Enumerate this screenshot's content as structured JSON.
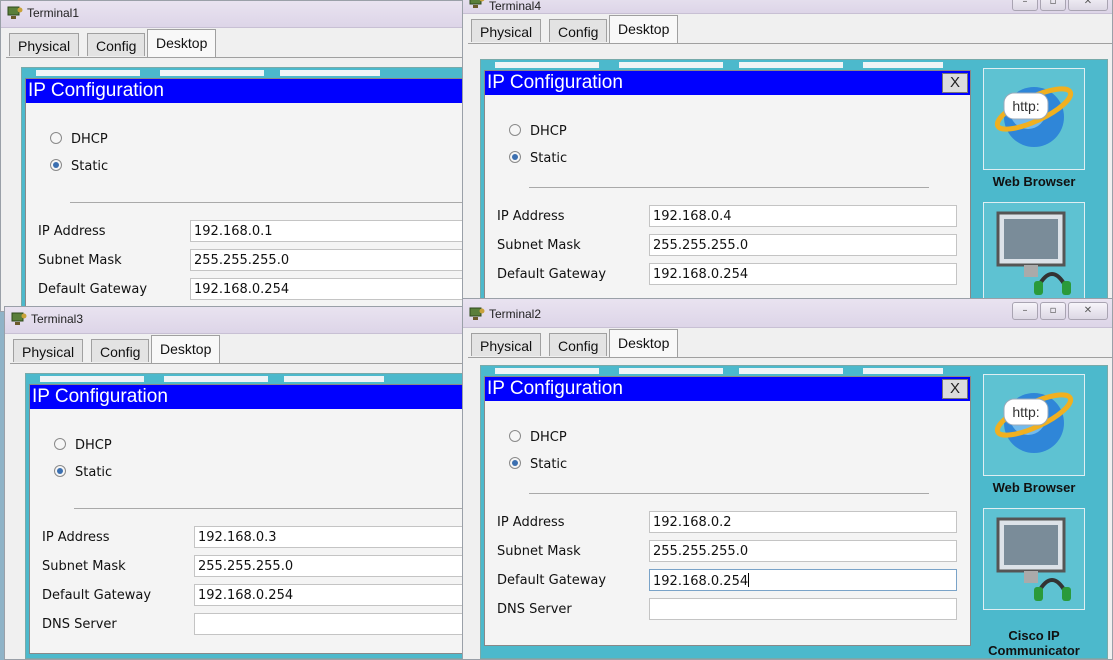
{
  "windows": {
    "terminal1": {
      "title": "Terminal1",
      "tabs": [
        "Physical",
        "Config",
        "Desktop"
      ],
      "panel_title": "IP Configuration",
      "dhcp_label": "DHCP",
      "static_label": "Static",
      "selected_mode": "Static",
      "ip_label": "IP Address",
      "ip_value": "192.168.0.1",
      "mask_label": "Subnet Mask",
      "mask_value": "255.255.255.0",
      "gw_label": "Default Gateway",
      "gw_value": "192.168.0.254"
    },
    "terminal4": {
      "title": "Terminal4",
      "tabs": [
        "Physical",
        "Config",
        "Desktop"
      ],
      "panel_title": "IP Configuration",
      "close_label": "X",
      "dhcp_label": "DHCP",
      "static_label": "Static",
      "selected_mode": "Static",
      "ip_label": "IP Address",
      "ip_value": "192.168.0.4",
      "mask_label": "Subnet Mask",
      "mask_value": "255.255.255.0",
      "gw_label": "Default Gateway",
      "gw_value": "192.168.0.254",
      "apps": [
        "Web Browser"
      ],
      "web_icon_text": "http:"
    },
    "terminal3": {
      "title": "Terminal3",
      "tabs": [
        "Physical",
        "Config",
        "Desktop"
      ],
      "panel_title": "IP Configuration",
      "dhcp_label": "DHCP",
      "static_label": "Static",
      "selected_mode": "Static",
      "ip_label": "IP Address",
      "ip_value": "192.168.0.3",
      "mask_label": "Subnet Mask",
      "mask_value": "255.255.255.0",
      "gw_label": "Default Gateway",
      "gw_value": "192.168.0.254",
      "dns_label": "DNS Server",
      "dns_value": ""
    },
    "terminal2": {
      "title": "Terminal2",
      "tabs": [
        "Physical",
        "Config",
        "Desktop"
      ],
      "panel_title": "IP Configuration",
      "close_label": "X",
      "dhcp_label": "DHCP",
      "static_label": "Static",
      "selected_mode": "Static",
      "ip_label": "IP Address",
      "ip_value": "192.168.0.2",
      "mask_label": "Subnet Mask",
      "mask_value": "255.255.255.0",
      "gw_label": "Default Gateway",
      "gw_value": "192.168.0.254",
      "dns_label": "DNS Server",
      "dns_value": "",
      "apps": [
        "Web Browser",
        "Cisco IP Communicator"
      ],
      "web_icon_text": "http:"
    }
  },
  "icons": {
    "window": "packet-tracer-pc-icon",
    "minimize": "minimize-icon",
    "maximize": "maximize-icon",
    "close": "close-icon",
    "web_browser": "web-browser-globe-icon",
    "ip_communicator": "ip-communicator-monitor-headset-icon"
  },
  "colors": {
    "ip_config_header": "#0000ff",
    "desktop_background": "#4cb9cc",
    "radio_selected": "#3b6fb0"
  }
}
